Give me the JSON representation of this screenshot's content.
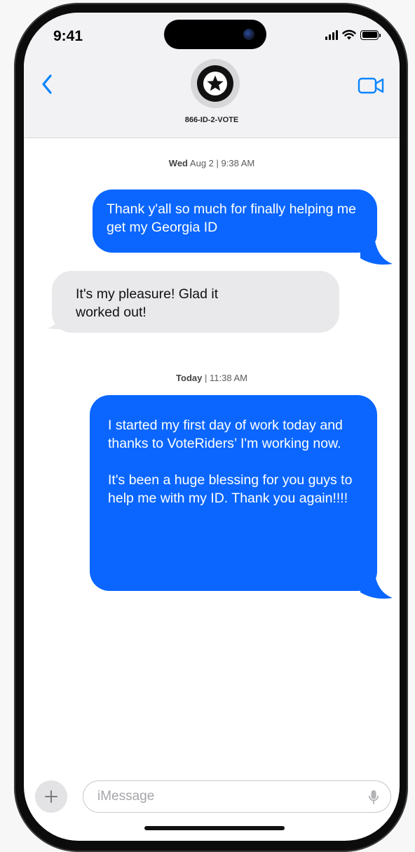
{
  "status_bar": {
    "time": "9:41",
    "icons": [
      "signal-icon",
      "wifi-icon",
      "battery-icon"
    ]
  },
  "header": {
    "back_icon": "chevron-left-icon",
    "contact_icon": "star-icon",
    "contact_name": "866-ID-2-VOTE",
    "video_icon": "video-camera-icon"
  },
  "conversation": {
    "groups": [
      {
        "timestamp": {
          "day": "Wed",
          "rest": "Aug 2 | 9:38 AM"
        },
        "messages": [
          {
            "direction": "outgoing",
            "paragraphs": [
              "Thank y'all so much for finally helping me get my Georgia ID"
            ]
          },
          {
            "direction": "incoming",
            "paragraphs": [
              "It's my pleasure! Glad it worked out!"
            ]
          }
        ]
      },
      {
        "timestamp": {
          "day": "Today",
          "rest": "| 11:38 AM"
        },
        "messages": [
          {
            "direction": "outgoing",
            "paragraphs": [
              "I started my first day of work today and thanks to VoteRiders’ I'm working now.",
              "It's been a huge blessing for you guys to help me with my ID. Thank you again!!!!"
            ]
          }
        ]
      }
    ]
  },
  "composer": {
    "plus_icon": "plus-icon",
    "placeholder": "iMessage",
    "mic_icon": "microphone-icon"
  },
  "colors": {
    "outgoing_bubble": "#0a66ff",
    "incoming_bubble": "#e9e9eb",
    "accent": "#0a84ff"
  }
}
